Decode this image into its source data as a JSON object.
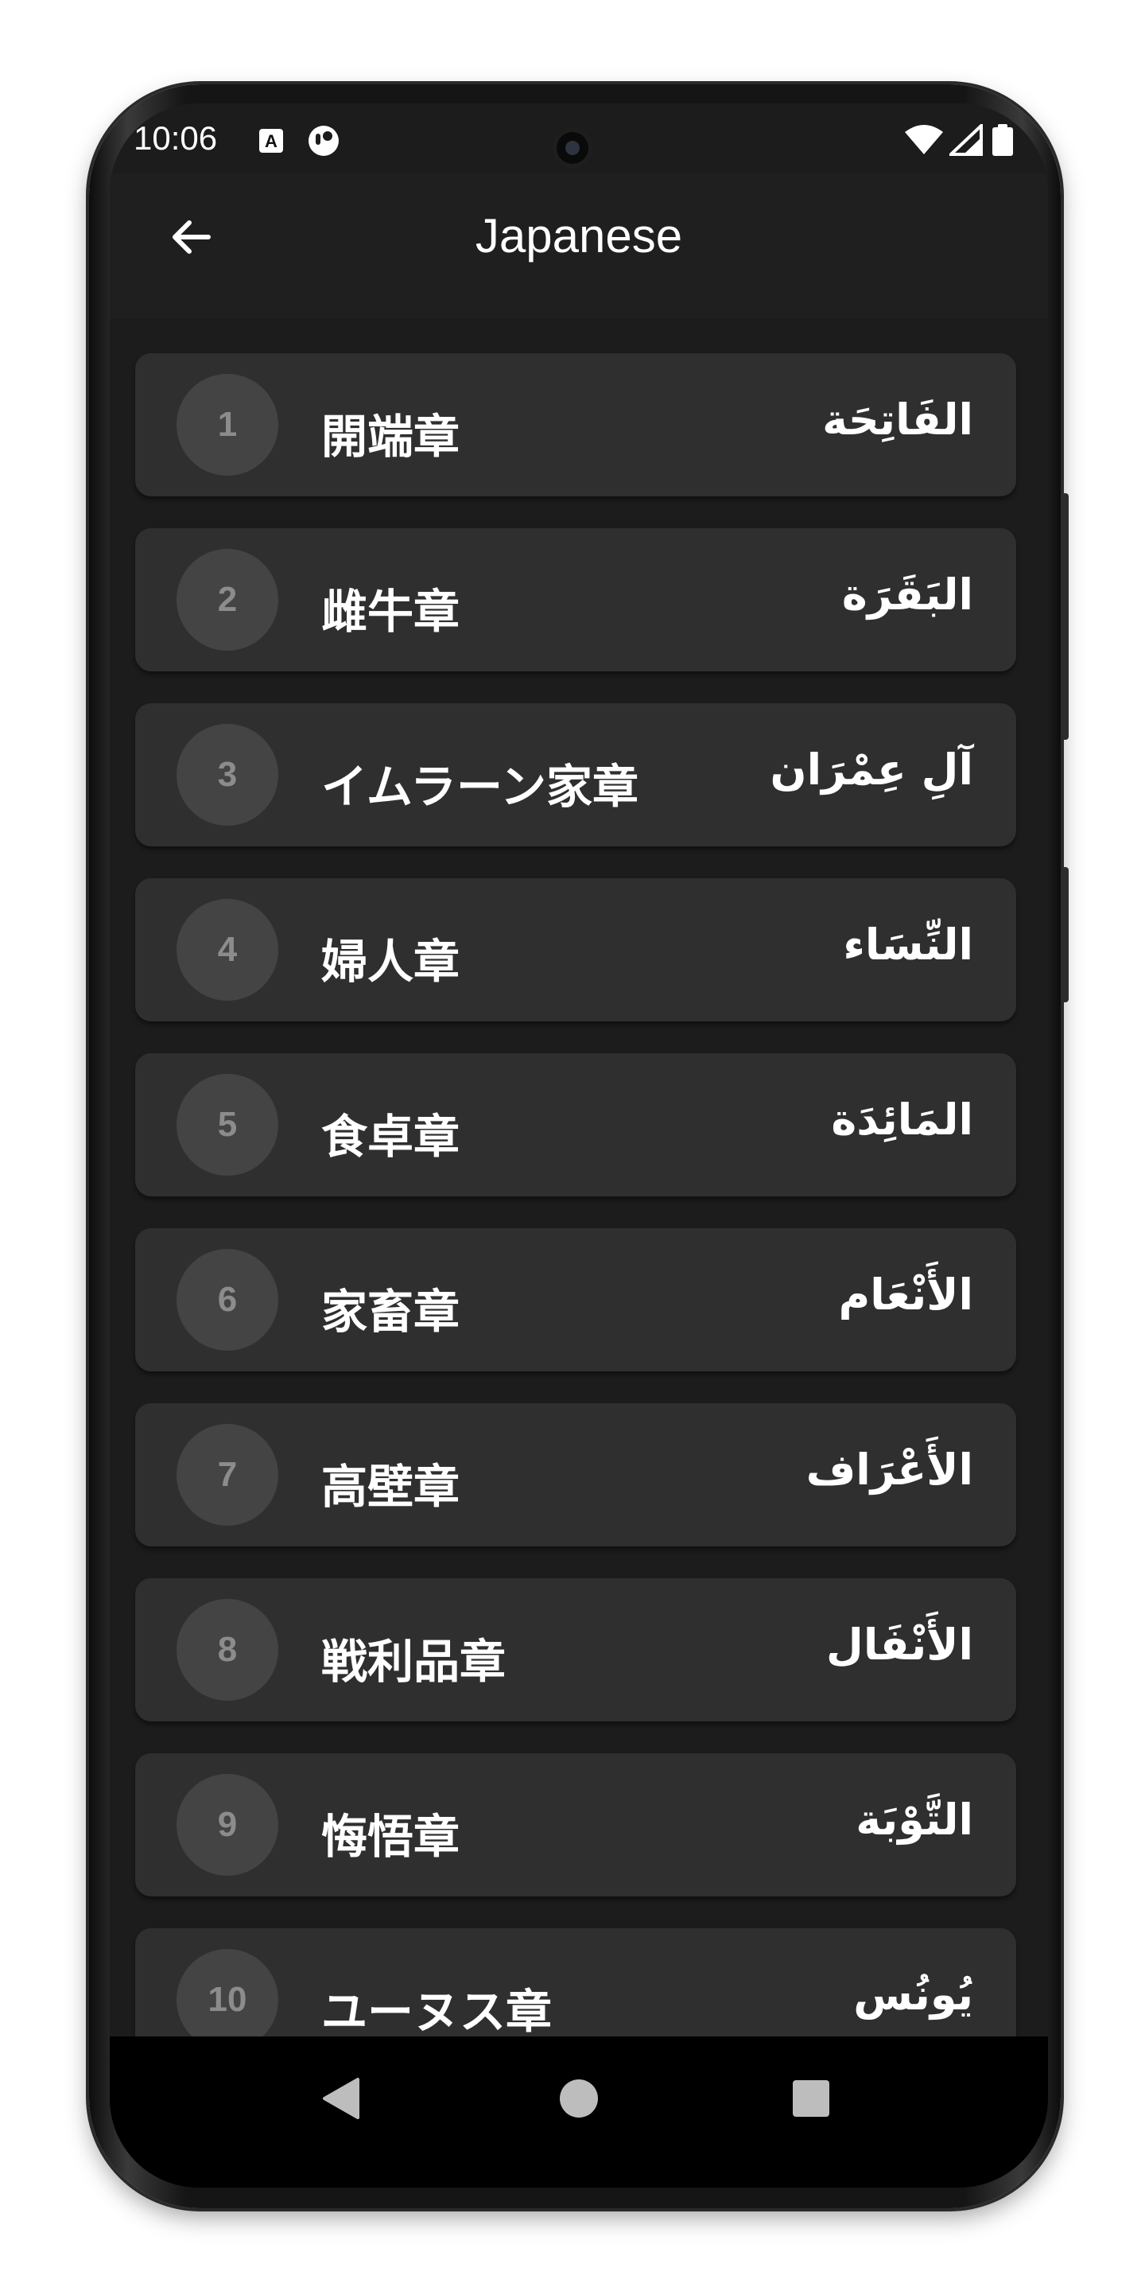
{
  "status_bar": {
    "time": "10:06",
    "icons": [
      "a-notification-icon",
      "circle-app-notification-icon",
      "wifi-icon",
      "signal-icon",
      "battery-icon"
    ]
  },
  "app_bar": {
    "title": "Japanese",
    "back_icon": "arrow-left-icon"
  },
  "surahs": [
    {
      "number": "1",
      "japanese": "開端章",
      "arabic": "الفَاتِحَة"
    },
    {
      "number": "2",
      "japanese": "雌牛章",
      "arabic": "البَقَرَة"
    },
    {
      "number": "3",
      "japanese": "イムラーン家章",
      "arabic": "آلِ عِمْرَان"
    },
    {
      "number": "4",
      "japanese": "婦人章",
      "arabic": "النِّسَاء"
    },
    {
      "number": "5",
      "japanese": "食卓章",
      "arabic": "المَائِدَة"
    },
    {
      "number": "6",
      "japanese": "家畜章",
      "arabic": "الأَنْعَام"
    },
    {
      "number": "7",
      "japanese": "高壁章",
      "arabic": "الأَعْرَاف"
    },
    {
      "number": "8",
      "japanese": "戦利品章",
      "arabic": "الأَنْفَال"
    },
    {
      "number": "9",
      "japanese": "悔悟章",
      "arabic": "التَّوْبَة"
    },
    {
      "number": "10",
      "japanese": "ユーヌス章",
      "arabic": "يُونُس"
    }
  ],
  "nav_bar": {
    "icons": [
      "back-triangle-icon",
      "home-circle-icon",
      "recents-square-icon"
    ]
  },
  "colors": {
    "screen_background": "#1c1c1c",
    "card": "#2f2f2f",
    "number_circle": "#444444",
    "number_text": "#8c8c8c",
    "text": "#ffffff"
  }
}
